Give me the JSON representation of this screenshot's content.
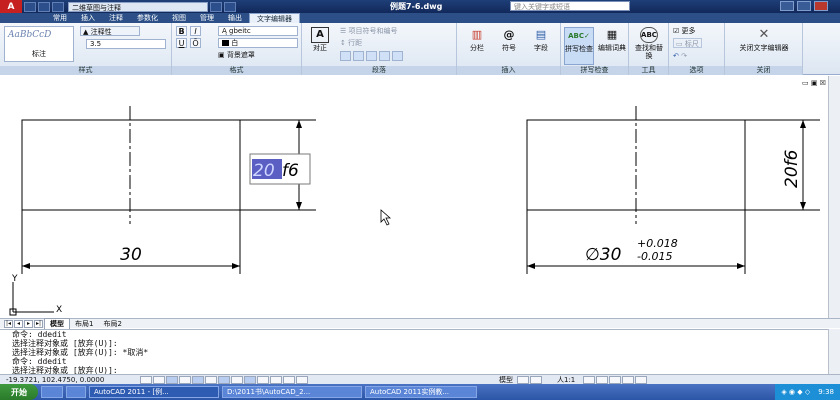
{
  "titlebar": {
    "app_logo": "A",
    "workspace": "二维草图与注释",
    "doc_title": "例题7-6.dwg",
    "help_search_placeholder": "键入关键字或短语"
  },
  "ribbon_tabs": [
    "常用",
    "插入",
    "注释",
    "参数化",
    "视图",
    "管理",
    "输出",
    "文字编辑器"
  ],
  "ribbon": {
    "style_panel": {
      "title": "样式",
      "style_sample": "AaBbCcD",
      "style_caption": "标注",
      "annotative": "注释性",
      "height": "3.5"
    },
    "format_panel": {
      "title": "格式",
      "bold": "B",
      "italic": "I",
      "underline": "U",
      "overline": "Ō",
      "font": "gbeitc",
      "color": "白",
      "bg_mask": "背景遮罩"
    },
    "paragraph_panel": {
      "title": "段落",
      "justify": "对正",
      "bullets": "项目符号和编号",
      "line_spacing": "行距"
    },
    "insert_panel": {
      "title": "插入",
      "columns": "分栏",
      "symbol": "符号",
      "field": "字段"
    },
    "spell_panel": {
      "title": "拼写检查",
      "spell_check": "拼写检查",
      "edit_dict": "编辑词典"
    },
    "tools_panel": {
      "title": "工具",
      "find_replace": "查找和替换"
    },
    "options_panel": {
      "title": "选项",
      "more": "更多",
      "ruler": "标尺"
    },
    "close_panel": {
      "title": "关闭",
      "close_editor": "关闭文字编辑器"
    }
  },
  "drawing": {
    "left_dim_h": "30",
    "left_dim_v_editing_selected": "20",
    "left_dim_v_editing_rest": "f6",
    "right_dim_h": "∅30",
    "right_tol_upper": "+0.018",
    "right_tol_lower": "-0.015",
    "right_dim_v": "20f6",
    "ucs_x": "X",
    "ucs_y": "Y"
  },
  "layout_tabs": [
    "模型",
    "布局1",
    "布局2"
  ],
  "command_history": [
    "命令: ddedit",
    "选择注释对象或 [放弃(U)]:",
    "选择注释对象或 [放弃(U)]: *取消*",
    "命令: ddedit",
    "选择注释对象或 [放弃(U)]:"
  ],
  "statusbar": {
    "coords": "-19.3721, 102.4750, 0.0000",
    "model": "模型",
    "scale": "人1:1"
  },
  "taskbar": {
    "start": "开始",
    "tasks": [
      "AutoCAD 2011 - [例...",
      "D:\\2011书\\AutoCAD_2...",
      "AutoCAD 2011实例教..."
    ],
    "clock": "9:38"
  }
}
